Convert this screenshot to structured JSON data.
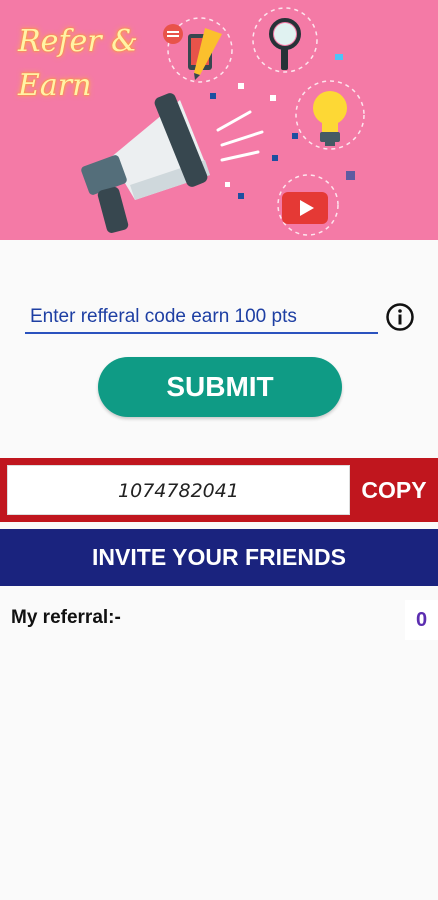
{
  "banner": {
    "title": "Refer &\nEarn",
    "background_color": "#f47aa6",
    "icons": [
      "megaphone-icon",
      "pencil-icon",
      "magnifier-icon",
      "lightbulb-icon",
      "play-icon",
      "chat-bubble-icon"
    ]
  },
  "referral_input": {
    "placeholder": "Enter refferal code earn 100 pts",
    "value": ""
  },
  "info_icon": "info-icon",
  "submit": {
    "label": "SUBMIT",
    "color": "#0f9b85"
  },
  "share": {
    "code": "1074782041",
    "copy_label": "COPY",
    "color": "#c0161e"
  },
  "invite": {
    "label": "INVITE YOUR FRIENDS",
    "color": "#1a237e"
  },
  "my_referral": {
    "label": "My referral:-",
    "count": "0"
  }
}
